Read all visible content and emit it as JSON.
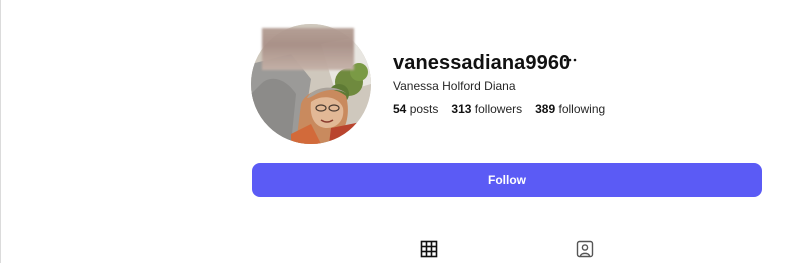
{
  "profile": {
    "username": "vanessadiana9960",
    "full_name": "Vanessa Holford Diana",
    "more_icon": "ellipsis-icon",
    "stats": {
      "posts_count": "54",
      "posts_label": "posts",
      "followers_count": "313",
      "followers_label": "followers",
      "following_count": "389",
      "following_label": "following"
    }
  },
  "actions": {
    "follow_label": "Follow"
  },
  "tabs": [
    {
      "icon": "grid-icon",
      "active": true
    },
    {
      "icon": "tagged-person-icon",
      "active": false
    }
  ],
  "colors": {
    "follow_button": "#5b5bf5",
    "text": "#111111"
  }
}
